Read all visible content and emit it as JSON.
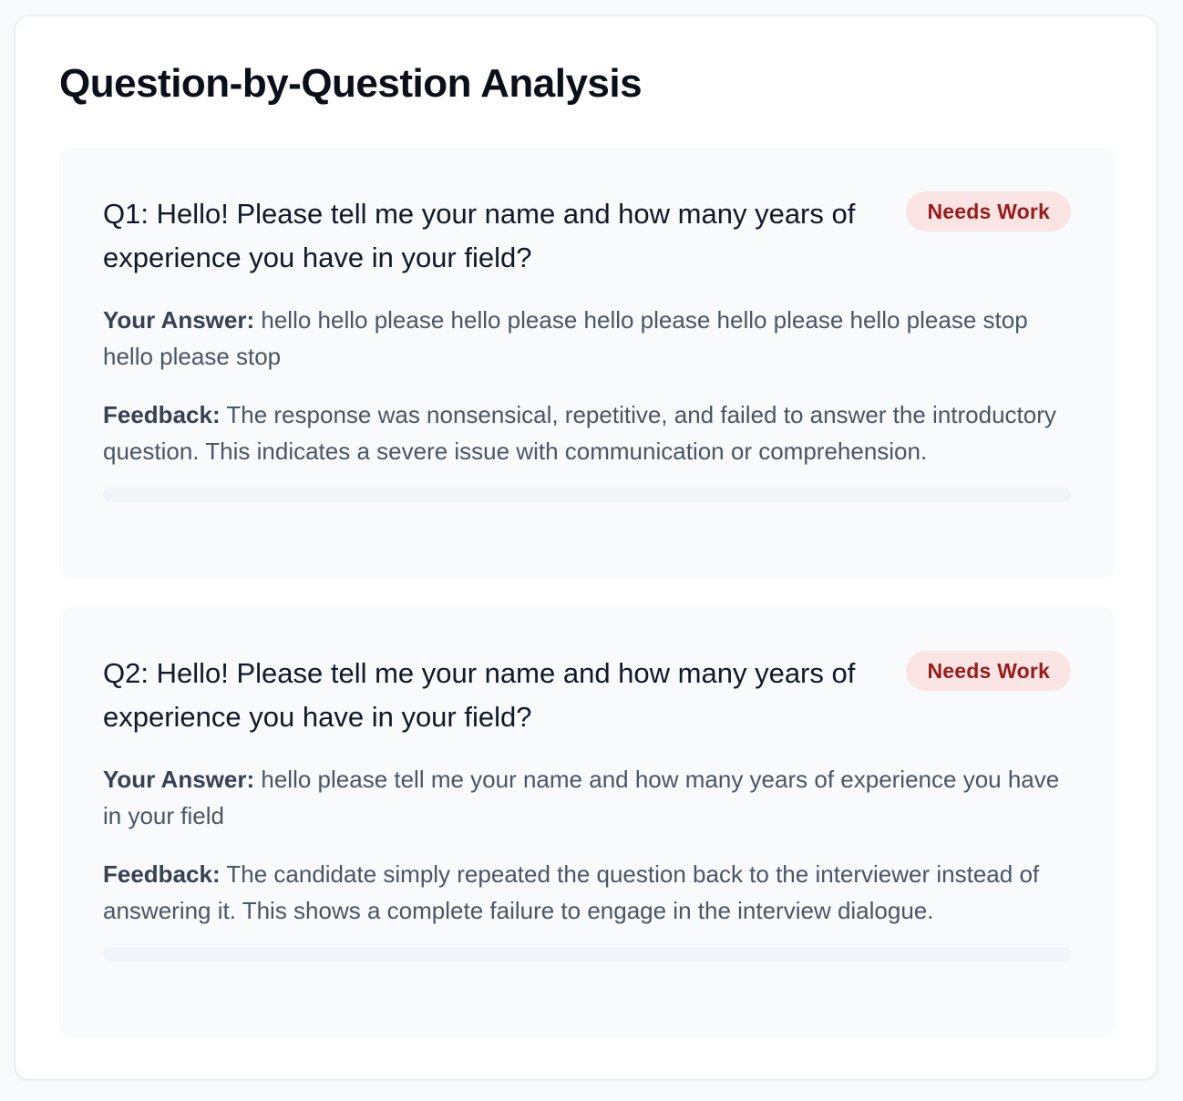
{
  "page": {
    "title": "Question-by-Question Analysis"
  },
  "labels": {
    "answer": "Your Answer:",
    "feedback": "Feedback:"
  },
  "questions": [
    {
      "title": "Q1: Hello! Please tell me your name and how many years of experience you have in your field?",
      "badge": "Needs Work",
      "answer": "hello hello please hello please hello please hello please hello please stop hello please stop",
      "feedback": "The response was nonsensical, repetitive, and failed to answer the introductory question. This indicates a severe issue with communication or comprehension.",
      "score_fraction": 0.0
    },
    {
      "title": "Q2: Hello! Please tell me your name and how many years of experience you have in your field?",
      "badge": "Needs Work",
      "answer": "hello please tell me your name and how many years of experience you have in your field",
      "feedback": "The candidate simply repeated the question back to the interviewer instead of answering it. This shows a complete failure to engage in the interview dialogue.",
      "score_fraction": 0.0
    }
  ],
  "colors": {
    "badge_background": "#fbe4e4",
    "badge_text": "#991b1b",
    "progress_track": "#f1f5f9"
  }
}
